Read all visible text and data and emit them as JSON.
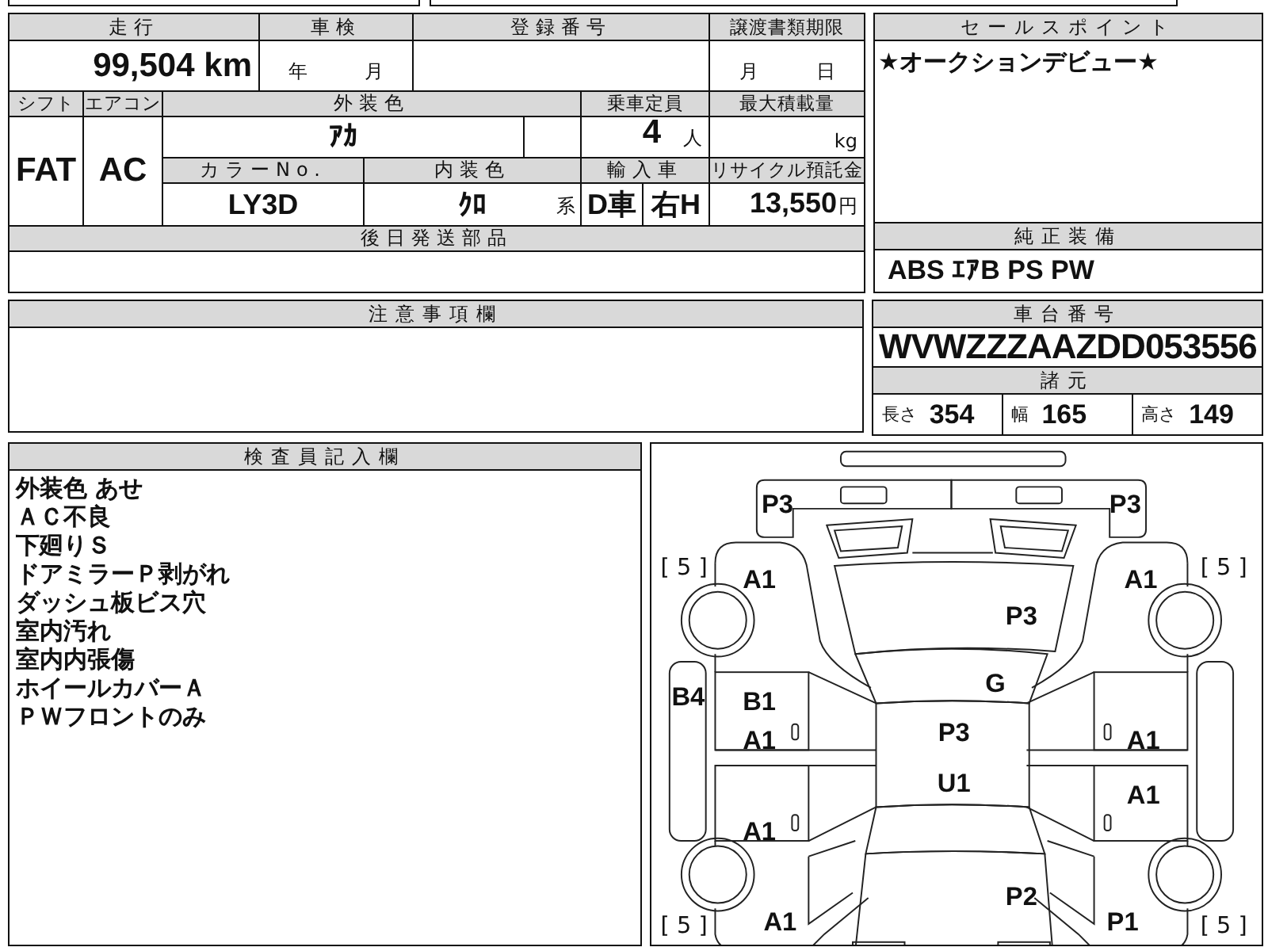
{
  "form": {
    "mileage": {
      "label": "走行",
      "value": "99,504",
      "unit": "km"
    },
    "inspection": {
      "label": "車検",
      "year_unit": "年",
      "month_unit": "月"
    },
    "registration_no": {
      "label": "登録番号"
    },
    "transfer_deadline": {
      "label": "譲渡書類期限",
      "month_unit": "月",
      "day_unit": "日"
    },
    "shift": {
      "label": "シフト",
      "value": "FAT"
    },
    "aircon": {
      "label": "エアコン",
      "value": "AC"
    },
    "exterior_color": {
      "label": "外装色",
      "value": "ｱｶ"
    },
    "capacity": {
      "label": "乗車定員",
      "value": "4",
      "unit": "人"
    },
    "max_load": {
      "label": "最大積載量",
      "unit": "kg"
    },
    "color_no": {
      "label": "カラーNo.",
      "value": "LY3D"
    },
    "interior_color": {
      "label": "内装色",
      "value": "ｸﾛ",
      "suffix": "系"
    },
    "import": {
      "label": "輸入車",
      "dealer": "D車",
      "steering": "右H"
    },
    "recycle_fee": {
      "label": "リサイクル預託金",
      "value": "13,550",
      "unit": "円"
    },
    "later_parts": {
      "label": "後日発送部品"
    }
  },
  "sales_point": {
    "label": "セールスポイント",
    "text": "★オークションデビュー★"
  },
  "standard_equipment": {
    "label": "純正装備",
    "value": "ABS ｴｱB PS PW"
  },
  "notes": {
    "label": "注意事項欄"
  },
  "chassis": {
    "label": "車台番号",
    "value": "WVWZZZAAZDD053556"
  },
  "specs": {
    "label": "諸元",
    "items": [
      {
        "label": "長さ",
        "value": "354"
      },
      {
        "label": "幅",
        "value": "165"
      },
      {
        "label": "高さ",
        "value": "149"
      }
    ]
  },
  "inspector": {
    "label": "検査員記入欄",
    "lines": [
      "外装色 あせ",
      "ＡＣ不良",
      "下廻りＳ",
      "ドアミラーＰ剥がれ",
      "ダッシュ板ビス穴",
      "室内汚れ",
      "室内内張傷",
      "ホイールカバーＡ",
      "ＰＷフロントのみ"
    ]
  },
  "diagram": {
    "marks": [
      {
        "kind": "damage",
        "text": "P3"
      },
      {
        "kind": "damage",
        "text": "P3"
      },
      {
        "kind": "tread",
        "text": "[ 5 ]"
      },
      {
        "kind": "tread",
        "text": "[ 5 ]"
      },
      {
        "kind": "damage",
        "text": "A1"
      },
      {
        "kind": "damage",
        "text": "A1"
      },
      {
        "kind": "damage",
        "text": "P3"
      },
      {
        "kind": "damage",
        "text": "G"
      },
      {
        "kind": "damage",
        "text": "B4"
      },
      {
        "kind": "damage",
        "text": "B1"
      },
      {
        "kind": "damage",
        "text": "A1"
      },
      {
        "kind": "damage",
        "text": "P3"
      },
      {
        "kind": "damage",
        "text": "A1"
      },
      {
        "kind": "damage",
        "text": "U1"
      },
      {
        "kind": "damage",
        "text": "A1"
      },
      {
        "kind": "damage",
        "text": "A1"
      },
      {
        "kind": "damage",
        "text": "P2"
      },
      {
        "kind": "tread",
        "text": "[ 5 ]"
      },
      {
        "kind": "damage",
        "text": "A1"
      },
      {
        "kind": "damage",
        "text": "P1"
      },
      {
        "kind": "tread",
        "text": "[ 5 ]"
      }
    ]
  }
}
